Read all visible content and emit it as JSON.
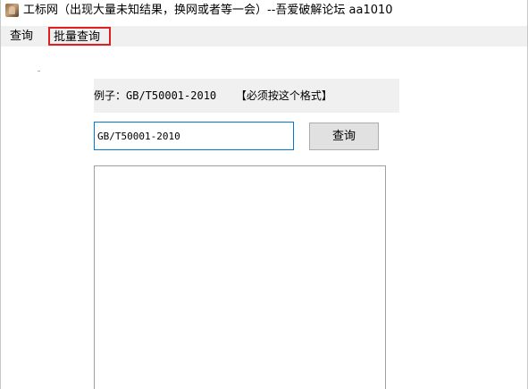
{
  "window": {
    "title": "工标网（出现大量未知结果，换网或者等一会）--吾爱破解论坛 aa1010",
    "icon": "app-icon"
  },
  "menu": {
    "items": [
      {
        "label": "查询"
      },
      {
        "label": "批量查询",
        "highlighted": true,
        "highlight_color": "#e02020"
      }
    ]
  },
  "main": {
    "hint": "例子：GB/T50001-2010   【必须按这个格式】",
    "input_value": "GB/T50001-2010",
    "query_button_label": "查询",
    "results_text": ""
  },
  "colors": {
    "accent": "#0078d7",
    "menu_bg": "#f0f0f0",
    "button_bg": "#e1e1e1",
    "highlight": "#e02020"
  }
}
